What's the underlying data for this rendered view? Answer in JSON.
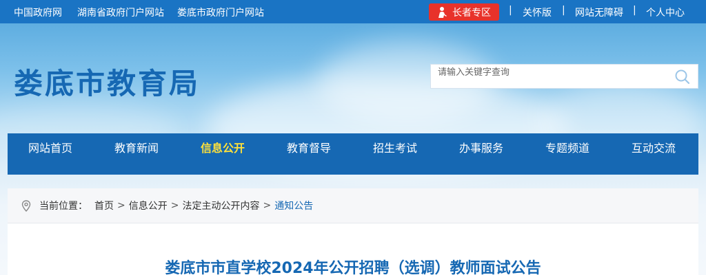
{
  "topbar": {
    "links": [
      "中国政府网",
      "湖南省政府门户网站",
      "娄底市政府门户网站"
    ],
    "elder_label": "长者专区",
    "right_links": [
      "关怀版",
      "网站无障碍",
      "个人中心"
    ],
    "separator": "|"
  },
  "header": {
    "site_title": "娄底市教育局",
    "search_placeholder": "请输入关键字查询"
  },
  "nav": {
    "items": [
      "网站首页",
      "教育新闻",
      "信息公开",
      "教育督导",
      "招生考试",
      "办事服务",
      "专题频道",
      "互动交流"
    ],
    "active": "信息公开"
  },
  "breadcrumb": {
    "prefix": "当前位置：",
    "items": [
      "首页",
      "信息公开",
      "法定主动公开内容",
      "通知公告"
    ],
    "separator": ">"
  },
  "article": {
    "title": "娄底市市直学校2024年公开招聘（选调）教师面试公告"
  },
  "colors": {
    "primary": "#1668b3",
    "topbar": "#1a74c4",
    "elder": "#e8322a",
    "nav_active": "#ffe13a"
  },
  "icons": {
    "elder": "elder-person-icon",
    "search": "search-icon",
    "location": "location-pin-icon"
  }
}
